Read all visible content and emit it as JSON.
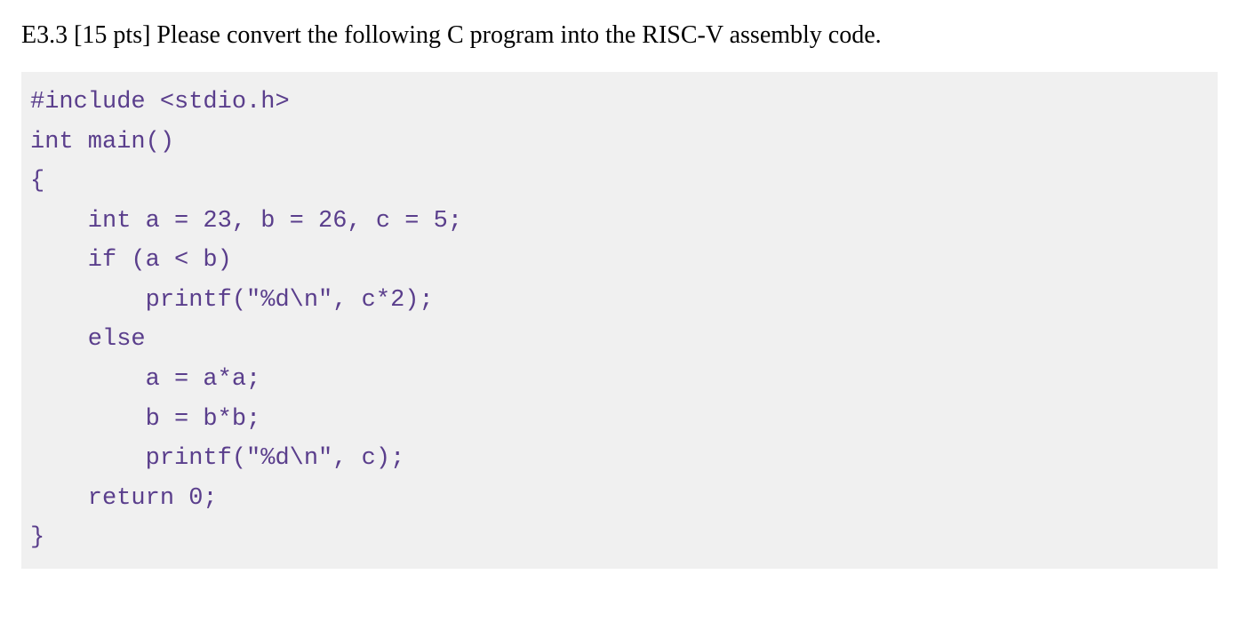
{
  "question": "E3.3 [15 pts] Please convert the following C program into the RISC-V assembly code.",
  "code": {
    "line1": "#include <stdio.h>",
    "line2": "",
    "line3": "int main()",
    "line4": "{",
    "line5": "    int a = 23, b = 26, c = 5;",
    "line6": "    if (a < b)",
    "line7": "        printf(\"%d\\n\", c*2);",
    "line8": "    else",
    "line9": "        a = a*a;",
    "line10": "        b = b*b;",
    "line11": "        printf(\"%d\\n\", c);",
    "line12": "    return 0;",
    "line13": "}"
  }
}
